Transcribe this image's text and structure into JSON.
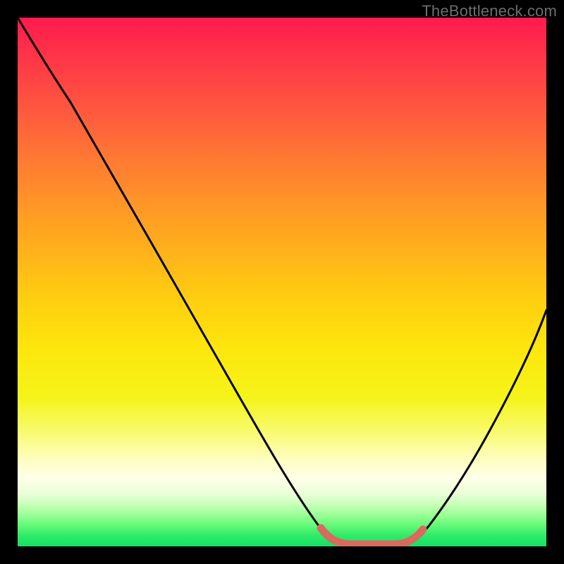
{
  "watermark": "TheBottleneck.com",
  "colors": {
    "background": "#000000",
    "curve_stroke": "#000000",
    "accent_segment": "#d86a5e",
    "gradient_stops": [
      "#ff1a4e",
      "#ff3a47",
      "#ff5a3e",
      "#ff7a33",
      "#ff9826",
      "#ffb41a",
      "#ffd010",
      "#fde70d",
      "#f4f41a",
      "#f8fa6a",
      "#fdfdb8",
      "#ffffe8",
      "#eaffd8",
      "#c8ffba",
      "#9cff96",
      "#64f878",
      "#2feb69",
      "#13e064"
    ]
  },
  "chart_data": {
    "type": "line",
    "title": "",
    "xlabel": "",
    "ylabel": "",
    "xlim": [
      0,
      100
    ],
    "ylim": [
      0,
      100
    ],
    "x": [
      0,
      5,
      10,
      15,
      20,
      25,
      30,
      35,
      40,
      45,
      50,
      55,
      58,
      62,
      66,
      70,
      74,
      78,
      82,
      86,
      90,
      94,
      100
    ],
    "values": [
      100,
      94,
      86,
      78,
      70,
      61,
      52,
      43,
      34,
      25,
      16,
      7,
      2,
      0,
      0,
      0,
      0,
      1,
      5,
      12,
      21,
      32,
      52
    ],
    "accent_range_x": [
      58,
      74
    ],
    "note": "V-shaped bottleneck curve; y≈0 (optimal) around x 62–72; background is a vertical heat gradient from red (worst, top) to green (best, bottom)."
  }
}
